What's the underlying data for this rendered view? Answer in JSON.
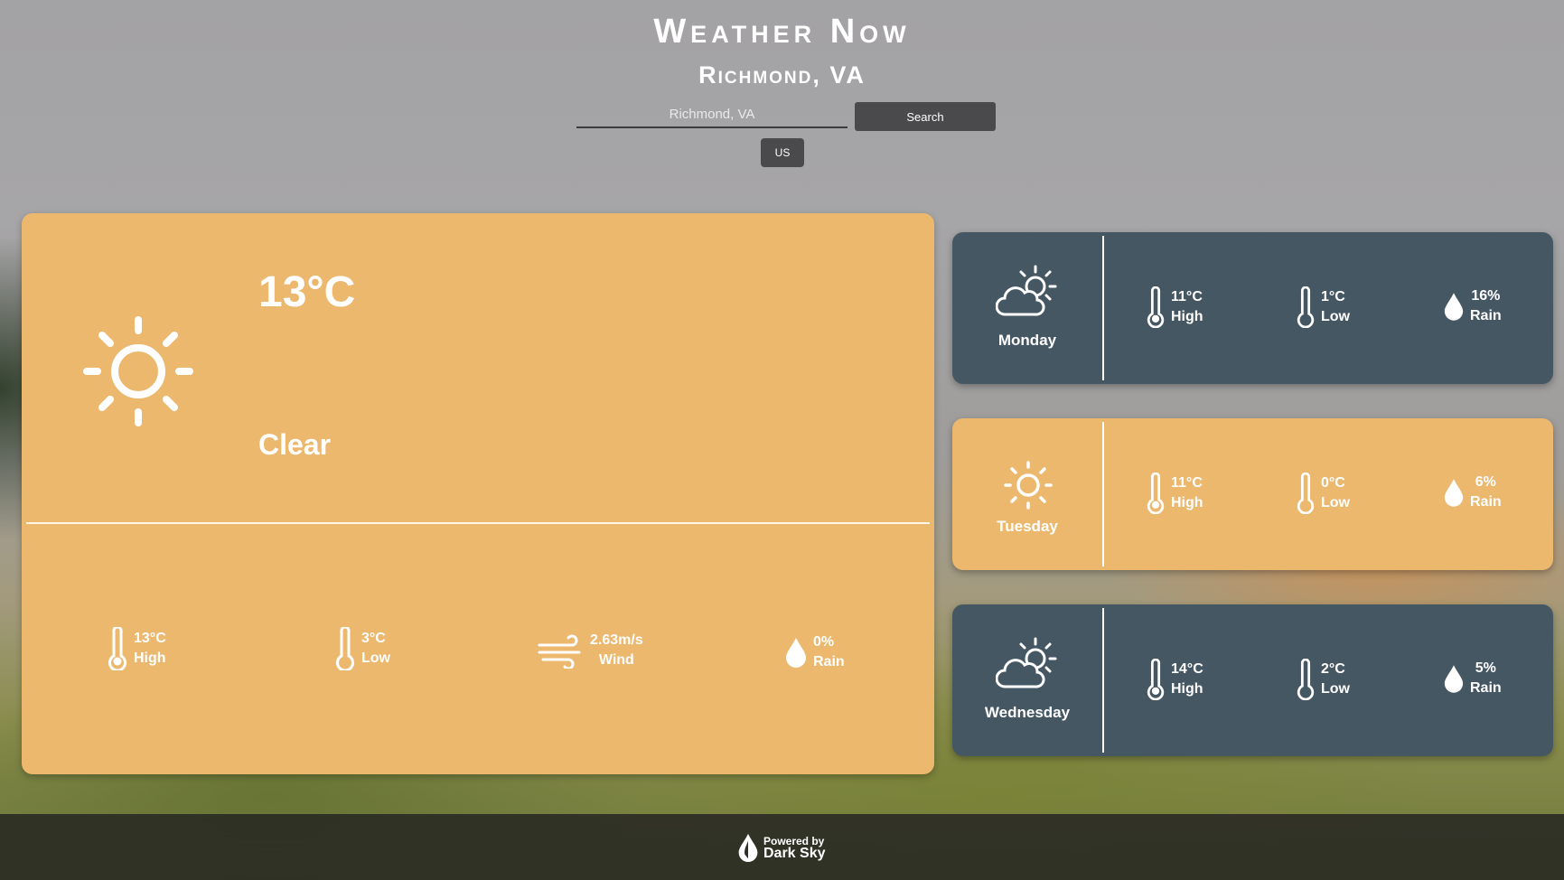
{
  "header": {
    "title": "Weather Now",
    "location": "Richmond, VA",
    "search_placeholder": "Richmond, VA",
    "search_label": "Search",
    "units_label": "US"
  },
  "current": {
    "icon": "sun-icon",
    "temp": "13°C",
    "summary": "Clear",
    "high_value": "13°C",
    "high_label": "High",
    "low_value": "3°C",
    "low_label": "Low",
    "wind_value": "2.63m/s",
    "wind_label": "Wind",
    "rain_value": "0%",
    "rain_label": "Rain"
  },
  "forecast": [
    {
      "day": "Monday",
      "icon": "partly-cloudy-icon",
      "high": "11°C",
      "high_label": "High",
      "low": "1°C",
      "low_label": "Low",
      "rain": "16%",
      "rain_label": "Rain"
    },
    {
      "day": "Tuesday",
      "icon": "sun-icon",
      "high": "11°C",
      "high_label": "High",
      "low": "0°C",
      "low_label": "Low",
      "rain": "6%",
      "rain_label": "Rain"
    },
    {
      "day": "Wednesday",
      "icon": "partly-cloudy-icon",
      "high": "14°C",
      "high_label": "High",
      "low": "2°C",
      "low_label": "Low",
      "rain": "5%",
      "rain_label": "Rain"
    }
  ],
  "footer": {
    "powered_by": "Powered by",
    "brand": "Dark Sky"
  },
  "colors": {
    "card_light": "#ebb86e",
    "card_dark": "#465764",
    "button": "#4a4a4c"
  }
}
